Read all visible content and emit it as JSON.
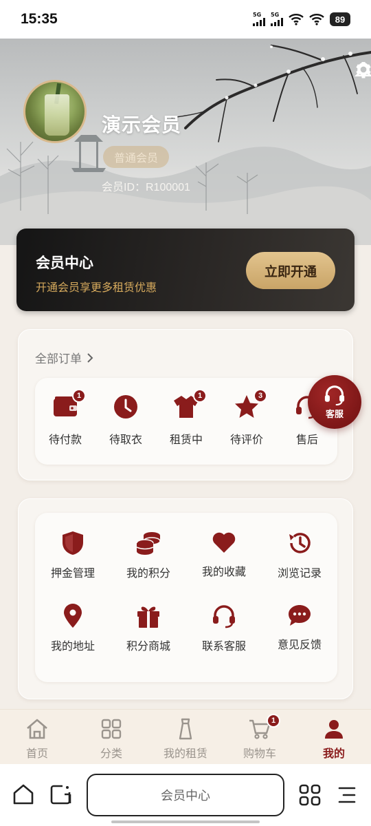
{
  "status_bar": {
    "time": "15:35",
    "signal1": "5G",
    "signal2": "5G",
    "battery": "89"
  },
  "header": {
    "user_name": "演示会员",
    "member_level": "普通会员",
    "member_id": "会员ID：R100001",
    "icons": [
      "settings-icon",
      "bell-icon"
    ]
  },
  "member_card": {
    "title": "会员中心",
    "subtitle": "开通会员享更多租赁优惠",
    "button": "立即开通"
  },
  "orders": {
    "header": "全部订单",
    "items": [
      {
        "label": "待付款",
        "icon": "wallet-icon",
        "badge": "1"
      },
      {
        "label": "待取衣",
        "icon": "clock-icon",
        "badge": ""
      },
      {
        "label": "租赁中",
        "icon": "shirt-icon",
        "badge": "1"
      },
      {
        "label": "待评价",
        "icon": "star-icon",
        "badge": "3"
      },
      {
        "label": "售后",
        "icon": "headset-icon",
        "badge": ""
      }
    ]
  },
  "services": {
    "items": [
      {
        "label": "押金管理",
        "icon": "shield-icon"
      },
      {
        "label": "我的积分",
        "icon": "coins-icon"
      },
      {
        "label": "我的收藏",
        "icon": "heart-icon"
      },
      {
        "label": "浏览记录",
        "icon": "history-icon"
      },
      {
        "label": "我的地址",
        "icon": "location-pin-icon"
      },
      {
        "label": "积分商城",
        "icon": "gift-icon"
      },
      {
        "label": "联系客服",
        "icon": "headset-icon"
      },
      {
        "label": "意见反馈",
        "icon": "chat-bubble-icon"
      }
    ]
  },
  "float_service": {
    "label": "客服"
  },
  "tabbar": {
    "tabs": [
      {
        "label": "首页",
        "icon": "home-icon",
        "active": false
      },
      {
        "label": "分类",
        "icon": "grid-icon",
        "active": false
      },
      {
        "label": "我的租赁",
        "icon": "garment-icon",
        "active": false
      },
      {
        "label": "购物车",
        "icon": "cart-icon",
        "active": false,
        "badge": "1"
      },
      {
        "label": "我的",
        "icon": "user-icon",
        "active": true
      }
    ]
  },
  "browser": {
    "address": "会员中心"
  },
  "colors": {
    "accent": "#8a1c1c",
    "gold": "#d6aa5d",
    "card_dark": "#1c1a19"
  }
}
